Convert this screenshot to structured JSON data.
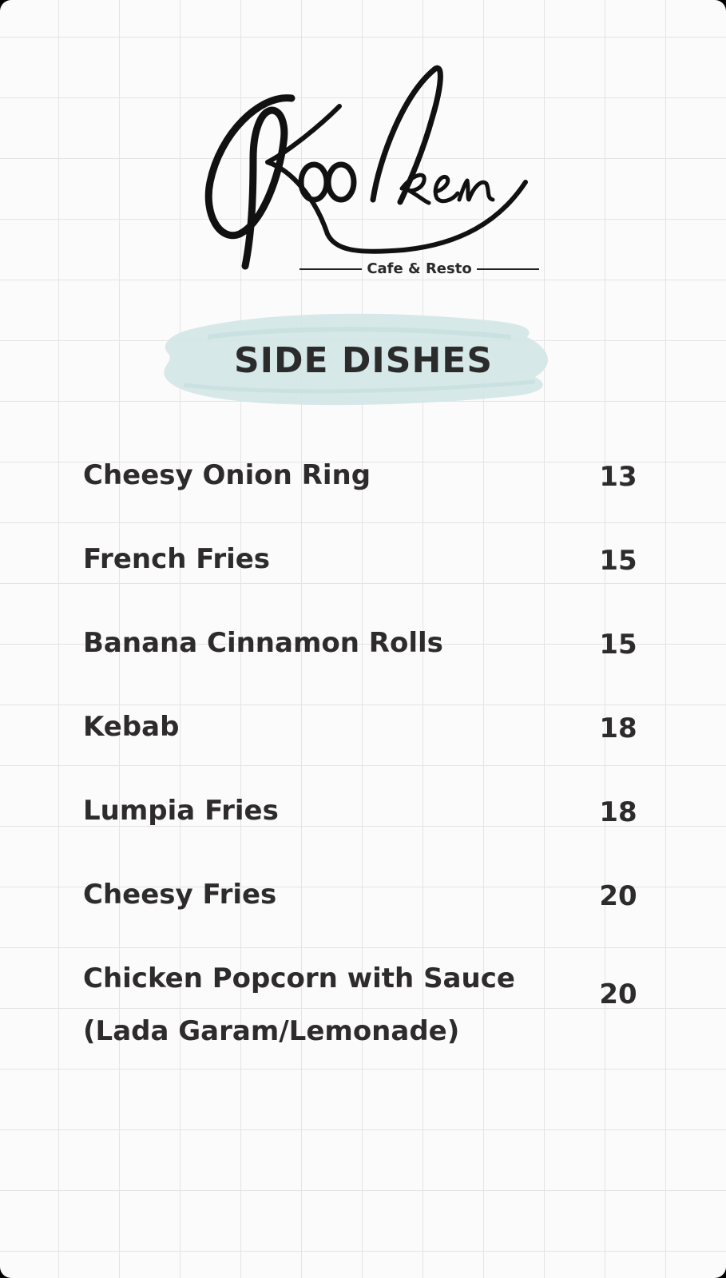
{
  "brand": {
    "name": "Kooken",
    "tagline": "Cafe & Resto"
  },
  "section": {
    "title": "SIDE DISHES"
  },
  "colors": {
    "text": "#2e2b2d",
    "brush": "#cfe2e2",
    "grid": "#e4e4e4"
  },
  "items": [
    {
      "name": "Cheesy Onion Ring",
      "price": "13"
    },
    {
      "name": "French Fries",
      "price": "15"
    },
    {
      "name": "Banana Cinnamon Rolls",
      "price": "15"
    },
    {
      "name": "Kebab",
      "price": "18"
    },
    {
      "name": "Lumpia Fries",
      "price": "18"
    },
    {
      "name": "Cheesy Fries",
      "price": "20"
    },
    {
      "name": "Chicken Popcorn with Sauce (Lada Garam/Lemonade)",
      "price": "20"
    }
  ]
}
